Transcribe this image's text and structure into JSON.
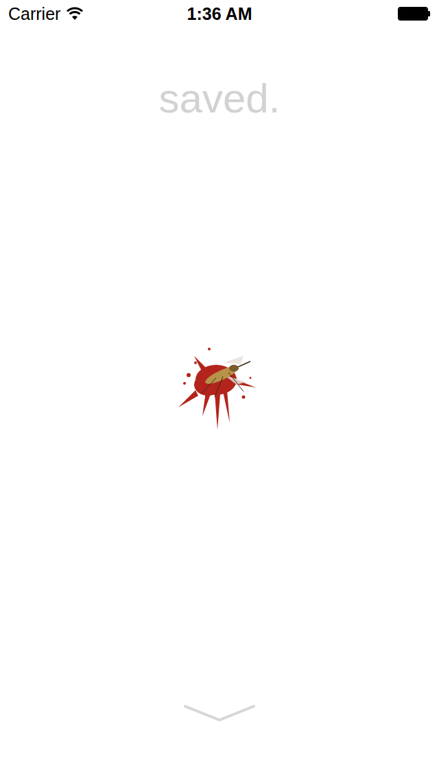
{
  "status_bar": {
    "carrier": "Carrier",
    "wifi": {
      "on": true
    },
    "time": "1:36 AM",
    "battery": {
      "level": 1.0
    }
  },
  "title": "saved."
}
